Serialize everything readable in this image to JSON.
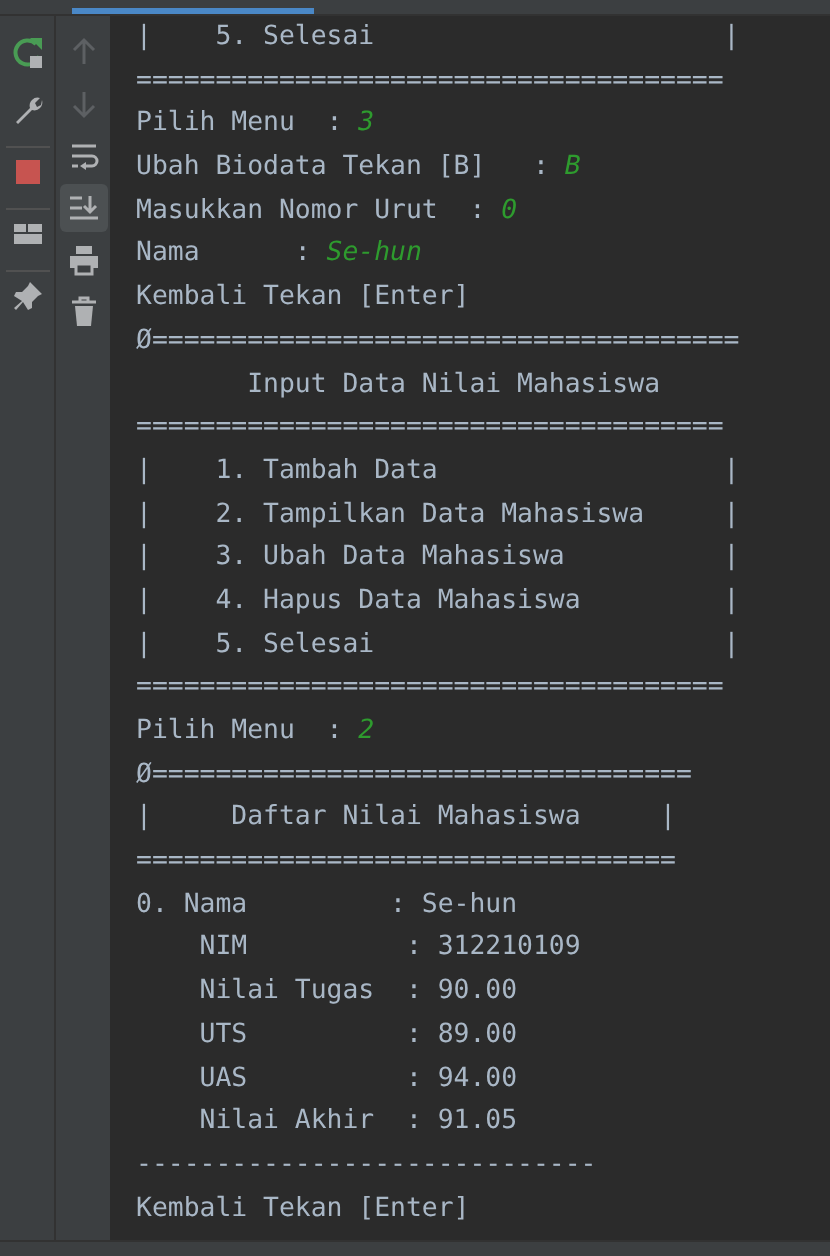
{
  "run_toolbar": {
    "groups": [
      [
        {
          "kind": "rerun"
        },
        {
          "kind": "wrench"
        }
      ],
      [
        {
          "kind": "stop"
        }
      ],
      [
        {
          "kind": "layout"
        }
      ],
      [
        {
          "kind": "pin"
        }
      ]
    ]
  },
  "console_toolbar": {
    "items": [
      {
        "kind": "up",
        "disabled": true,
        "selected": false
      },
      {
        "kind": "down",
        "disabled": true,
        "selected": false
      },
      {
        "kind": "wrap",
        "disabled": false,
        "selected": false
      },
      {
        "kind": "scroll-end",
        "disabled": false,
        "selected": true
      },
      {
        "kind": "print",
        "disabled": false,
        "selected": false
      },
      {
        "kind": "trash",
        "disabled": false,
        "selected": false
      }
    ]
  },
  "console": {
    "lines": [
      {
        "text": "|    5. Selesai                      |"
      },
      {
        "text": "====================================="
      },
      {
        "text": "Pilih Menu  : ",
        "input": "3"
      },
      {
        "text": "Ubah Biodata Tekan [B]   : ",
        "input": "B"
      },
      {
        "text": "Masukkan Nomor Urut  : ",
        "input": "0"
      },
      {
        "text": "Nama      : ",
        "input": "Se-hun"
      },
      {
        "text": "Kembali Tekan [Enter]"
      },
      {
        "text": "Ø====================================="
      },
      {
        "text": "       Input Data Nilai Mahasiswa"
      },
      {
        "text": "====================================="
      },
      {
        "text": "|    1. Tambah Data                  |"
      },
      {
        "text": "|    2. Tampilkan Data Mahasiswa     |"
      },
      {
        "text": "|    3. Ubah Data Mahasiswa          |"
      },
      {
        "text": "|    4. Hapus Data Mahasiswa         |"
      },
      {
        "text": "|    5. Selesai                      |"
      },
      {
        "text": "====================================="
      },
      {
        "text": "Pilih Menu  : ",
        "input": "2"
      },
      {
        "text": "Ø=================================="
      },
      {
        "text": "|     Daftar Nilai Mahasiswa     |"
      },
      {
        "text": "=================================="
      },
      {
        "text": "0. Nama         : Se-hun"
      },
      {
        "text": "    NIM          : 312210109"
      },
      {
        "text": "    Nilai Tugas  : 90.00"
      },
      {
        "text": "    UTS          : 89.00"
      },
      {
        "text": "    UAS          : 94.00"
      },
      {
        "text": "    Nilai Akhir  : 91.05"
      },
      {
        "text": "-----------------------------"
      },
      {
        "text": "Kembali Tekan [Enter]"
      }
    ]
  }
}
